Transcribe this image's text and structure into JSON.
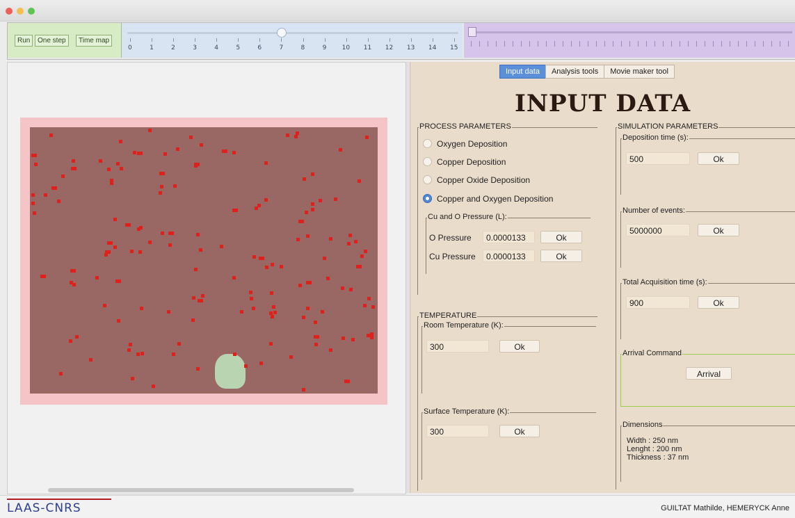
{
  "toolbar": {
    "run_label": "Run",
    "one_step_label": "One step",
    "time_map_label": "Time map",
    "time_slider": {
      "ticks": [
        "0",
        "1",
        "2",
        "3",
        "4",
        "5",
        "6",
        "7",
        "8",
        "9",
        "10",
        "11",
        "12",
        "13",
        "14",
        "15"
      ],
      "value": 7
    }
  },
  "tabs": [
    {
      "label": "Input data",
      "active": true
    },
    {
      "label": "Analysis tools",
      "active": false
    },
    {
      "label": "Movie maker tool",
      "active": false
    }
  ],
  "page_title": "INPUT DATA",
  "process": {
    "title": "PROCESS PARAMETERS",
    "options": [
      {
        "label": "Oxygen Deposition",
        "selected": false
      },
      {
        "label": "Copper Deposition",
        "selected": false
      },
      {
        "label": "Copper Oxide Deposition",
        "selected": false
      },
      {
        "label": "Copper and Oxygen Deposition",
        "selected": true
      }
    ],
    "pressure": {
      "title": "Cu and O Pressure (L):",
      "o_label": "O Pressure",
      "o_value": "0.0000133",
      "cu_label": "Cu Pressure",
      "cu_value": "0.0000133",
      "ok_label": "Ok"
    }
  },
  "temperature": {
    "title": "TEMPERATURE",
    "room_title": "Room Temperature (K):",
    "room_value": "300",
    "surface_title": "Surface Temperature (K):",
    "surface_value": "300",
    "ok_label": "Ok"
  },
  "simulation": {
    "title": "SIMULATION PARAMETERS",
    "deposition_title": "Deposition time (s):",
    "deposition_value": "500",
    "events_title": "Number of events:",
    "events_value": "5000000",
    "acquisition_title": "Total Acquisition time (s):",
    "acquisition_value": "900",
    "ok_label": "Ok",
    "arrival_title": "Arrival Command",
    "arrival_button": "Arrival",
    "dimensions_title": "Dimensions",
    "width": "Width : 250 nm",
    "length": "Lenght : 200 nm",
    "thickness": "Thickness : 37 nm"
  },
  "footer": {
    "logo": "LAAS-CNRS",
    "credits": "GUILTAT Mathilde, HEMERYCK Anne"
  },
  "colors": {
    "accent": "#5b8fd9",
    "substrate": "#9a6864",
    "copper_atom": "#e0201a",
    "oxide_island": "#b8d4b0"
  }
}
